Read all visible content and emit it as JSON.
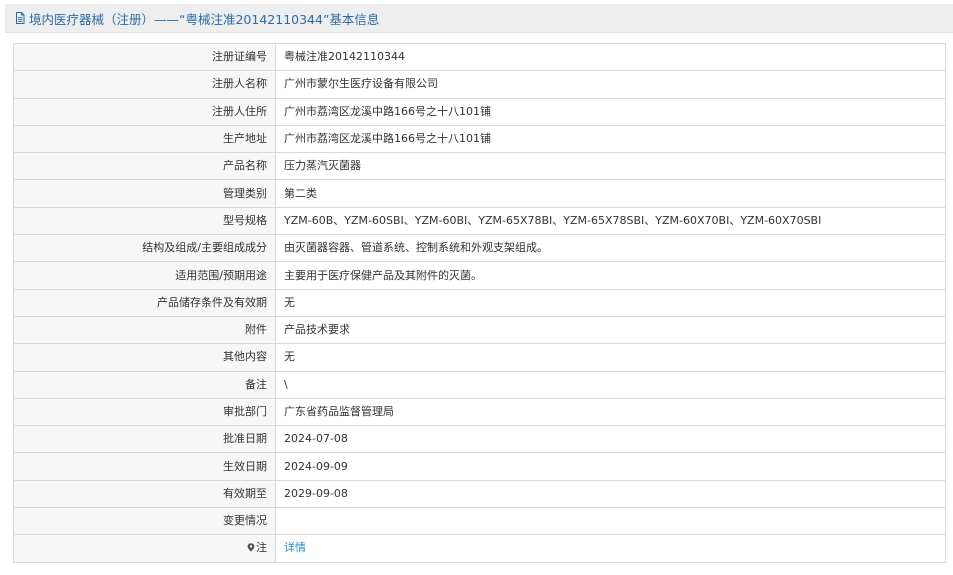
{
  "header": {
    "title": "境内医疗器械（注册）——“粤械注准20142110344”基本信息",
    "icon": "document-icon",
    "color": "#2a6cab"
  },
  "rows": [
    {
      "label": "注册证编号",
      "value": "粤械注准20142110344"
    },
    {
      "label": "注册人名称",
      "value": "广州市蒙尔生医疗设备有限公司"
    },
    {
      "label": "注册人住所",
      "value": "广州市荔湾区龙溪中路166号之十八101铺"
    },
    {
      "label": "生产地址",
      "value": "广州市荔湾区龙溪中路166号之十八101铺"
    },
    {
      "label": "产品名称",
      "value": "压力蒸汽灭菌器"
    },
    {
      "label": "管理类别",
      "value": "第二类"
    },
    {
      "label": "型号规格",
      "value": "YZM-60B、YZM-60SBⅠ、YZM-60BⅠ、YZM-65X78BⅠ、YZM-65X78SBⅠ、YZM-60X70BⅠ、YZM-60X70SBⅠ"
    },
    {
      "label": "结构及组成/主要组成成分",
      "value": "由灭菌器容器、管道系统、控制系统和外观支架组成。"
    },
    {
      "label": "适用范围/预期用途",
      "value": "主要用于医疗保健产品及其附件的灭菌。"
    },
    {
      "label": "产品储存条件及有效期",
      "value": "无"
    },
    {
      "label": "附件",
      "value": "产品技术要求"
    },
    {
      "label": "其他内容",
      "value": "无"
    },
    {
      "label": "备注",
      "value": "\\"
    },
    {
      "label": "审批部门",
      "value": "广东省药品监督管理局"
    },
    {
      "label": "批准日期",
      "value": "2024-07-08"
    },
    {
      "label": "生效日期",
      "value": "2024-09-09"
    },
    {
      "label": "有效期至",
      "value": "2029-09-08"
    },
    {
      "label": "变更情况",
      "value": ""
    }
  ],
  "note_row": {
    "label": "注",
    "icon": "location-pin-icon",
    "link_text": "详情",
    "link_color": "#2a8dd4"
  }
}
